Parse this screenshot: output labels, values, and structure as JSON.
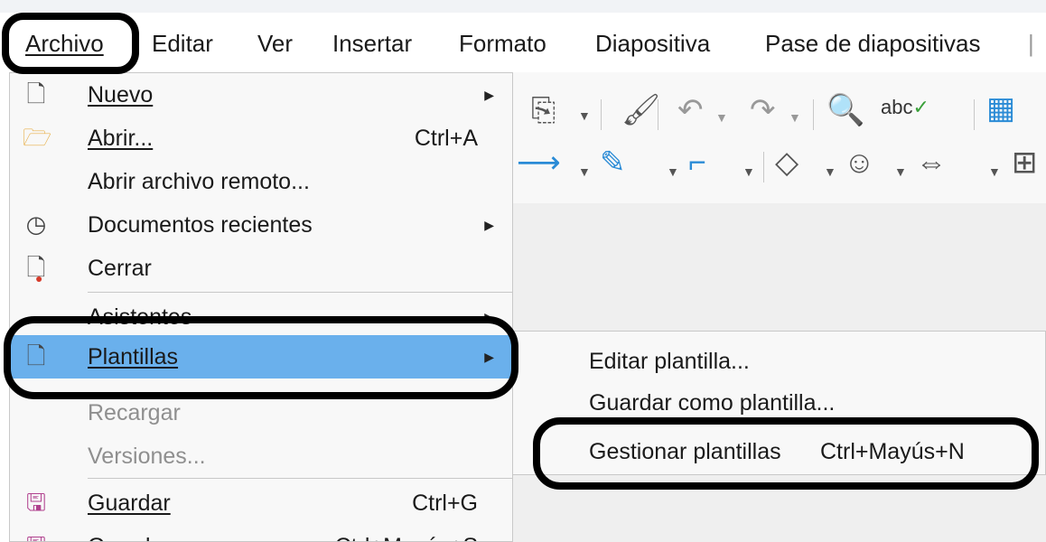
{
  "menubar": {
    "items": [
      {
        "label": "Archivo"
      },
      {
        "label": "Editar"
      },
      {
        "label": "Ver"
      },
      {
        "label": "Insertar"
      },
      {
        "label": "Formato"
      },
      {
        "label": "Diapositiva"
      },
      {
        "label": "Pase de diapositivas"
      }
    ]
  },
  "toolbar": {
    "icons": [
      "paste-icon",
      "clone-formatting-icon",
      "undo-icon",
      "redo-icon",
      "find-replace-icon",
      "spellcheck-icon",
      "grid-icon",
      "line-arrow-icon",
      "curve-icon",
      "connector-icon",
      "diamond-shape-icon",
      "smiley-shape-icon",
      "double-arrow-icon"
    ],
    "spell_text": "abc"
  },
  "file_menu": {
    "items": [
      {
        "label": "Nuevo",
        "icon": "new-document-icon",
        "submenu": true
      },
      {
        "label": "Abrir...",
        "icon": "folder-open-icon",
        "shortcut": "Ctrl+A"
      },
      {
        "label": "Abrir archivo remoto..."
      },
      {
        "label": "Documentos recientes",
        "icon": "clock-icon",
        "submenu": true
      },
      {
        "label": "Cerrar",
        "icon": "close-document-icon"
      },
      {
        "label": "Asistentes",
        "submenu": true
      },
      {
        "label": "Plantillas",
        "icon": "template-document-icon",
        "submenu": true,
        "highlighted": true
      },
      {
        "label": "Recargar",
        "disabled": true
      },
      {
        "label": "Versiones...",
        "disabled": true
      },
      {
        "label": "Guardar",
        "icon": "save-icon",
        "shortcut": "Ctrl+G"
      },
      {
        "label": "Guardar como...",
        "icon": "save-as-icon",
        "shortcut": "Ctrl+Mayús+S"
      }
    ]
  },
  "templates_submenu": {
    "items": [
      {
        "label": "Editar plantilla..."
      },
      {
        "label": "Guardar como plantilla..."
      },
      {
        "label": "Gestionar plantillas",
        "shortcut": "Ctrl+Mayús+N"
      }
    ]
  },
  "colors": {
    "highlight": "#6ab0ec",
    "menu_bg": "#f8f8f8",
    "annotation": "#000000",
    "save_icon": "#b0408e",
    "close_badge": "#d63b2a",
    "open_folder": "#e8b04a",
    "spellcheck_check": "#3aa03a",
    "toolbar_accent": "#2a8bd6"
  }
}
